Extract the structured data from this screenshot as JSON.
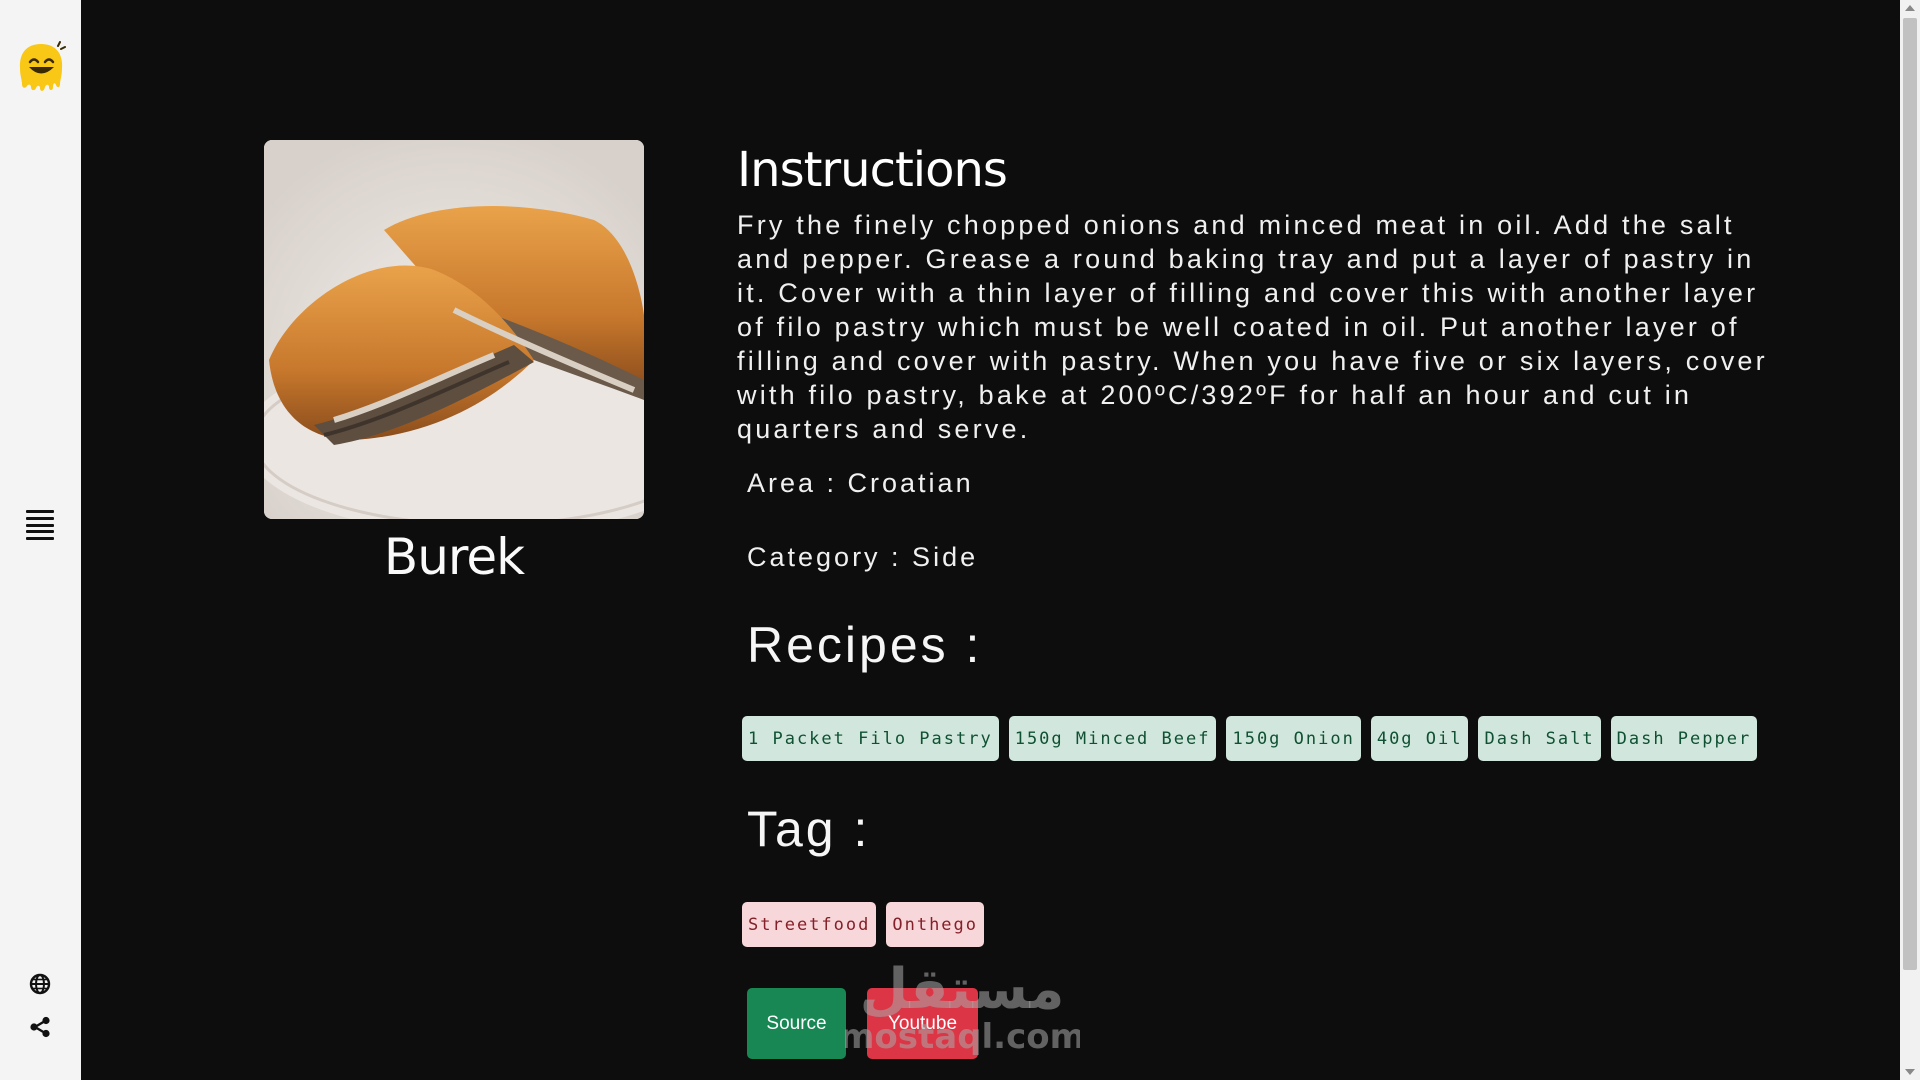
{
  "meal": {
    "name": "Burek",
    "image_alt": "Burek"
  },
  "instructions": {
    "title": "Instructions",
    "text": "Fry the finely chopped onions and minced meat in oil. Add the salt and pepper. Grease a round baking tray and put a layer of pastry in it. Cover with a thin layer of filling and cover this with another layer of filo pastry which must be well coated in oil. Put another layer of filling and cover with pastry. When you have five or six layers, cover with filo pastry, bake at 200ºC/392ºF for half an hour and cut in quarters and serve."
  },
  "area": "Area : Croatian",
  "category": "Category : Side",
  "recipes": {
    "title": "Recipes :",
    "items": [
      "1 Packet Filo Pastry",
      "150g Minced Beef",
      "150g Onion",
      "40g Oil",
      "Dash Salt",
      "Dash Pepper"
    ]
  },
  "tags": {
    "title": "Tag :",
    "items": [
      "Streetfood",
      "Onthego"
    ]
  },
  "buttons": {
    "source": "Source",
    "youtube": "Youtube"
  },
  "sidebar": {
    "icons": [
      "logo-icon",
      "menu-icon",
      "globe-icon",
      "share-icon"
    ]
  },
  "watermark": {
    "arabic": "مستقل",
    "latin": "mostaql.com"
  },
  "colors": {
    "background": "#0d0d0d",
    "sidebar": "#f4f4f4",
    "ingredient_chip": "#d1e7dd",
    "tag_chip": "#f8d7da",
    "source_button": "#198754",
    "youtube_button": "#dc3545"
  }
}
